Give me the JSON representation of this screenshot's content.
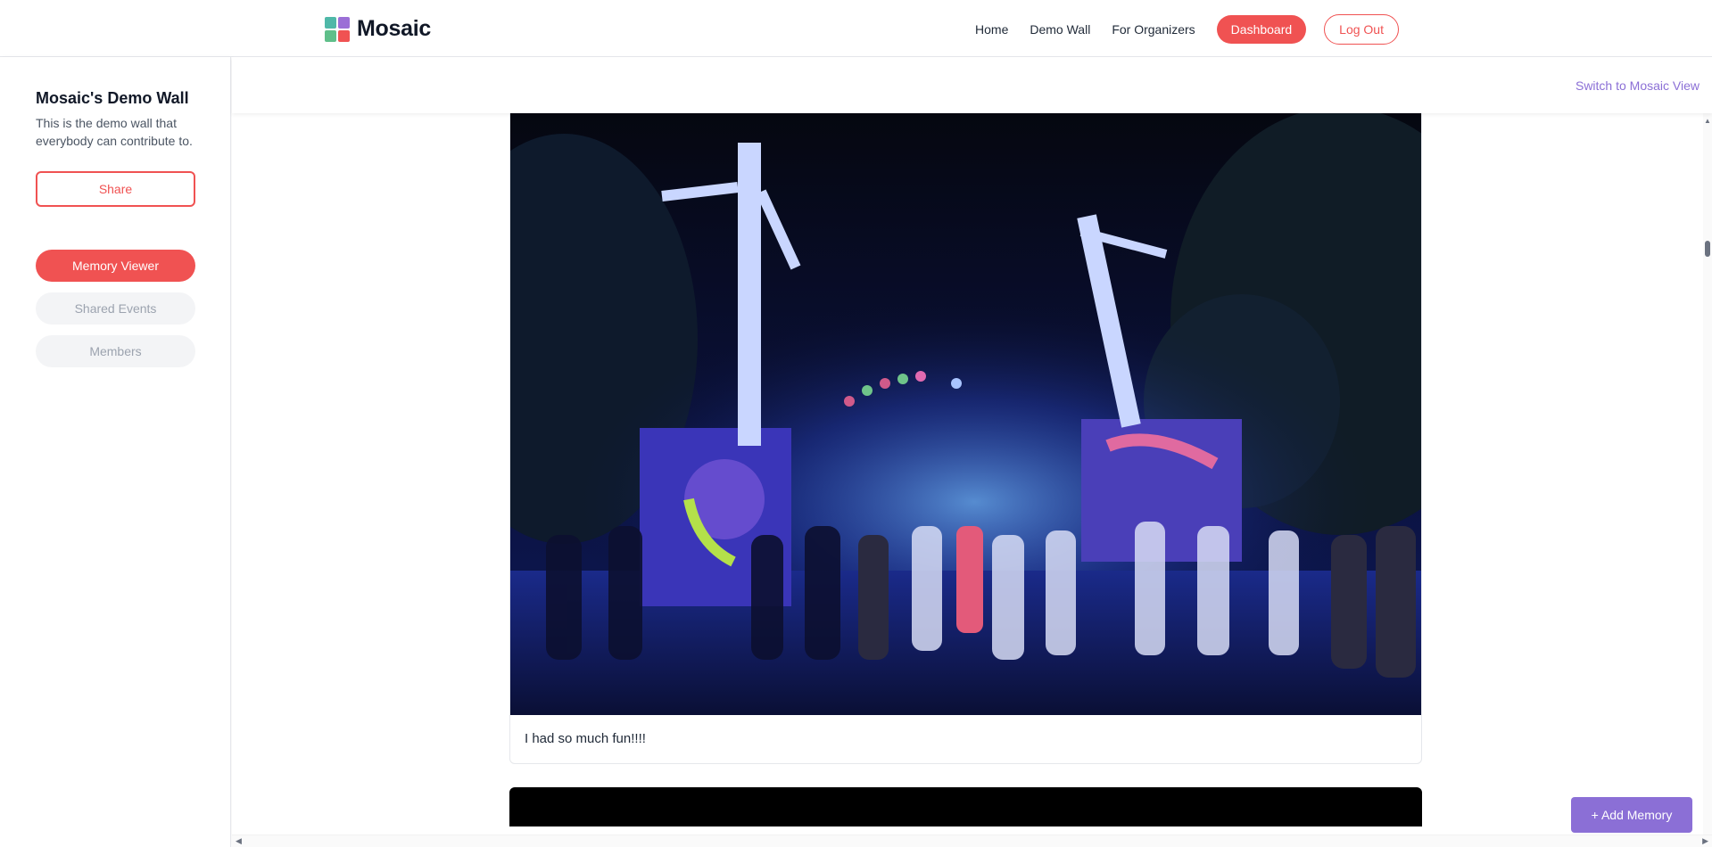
{
  "brand": {
    "name": "Mosaic",
    "logo_colors": [
      "#4fb8a8",
      "#9b6fd6",
      "#5fbf8a",
      "#f05252"
    ]
  },
  "nav": {
    "links": [
      "Home",
      "Demo Wall",
      "For Organizers"
    ],
    "dashboard_label": "Dashboard",
    "logout_label": "Log Out"
  },
  "sidebar": {
    "title": "Mosaic's Demo Wall",
    "description": "This is the demo wall that everybody can contribute to.",
    "share_label": "Share",
    "tabs": [
      {
        "label": "Memory Viewer",
        "active": true
      },
      {
        "label": "Shared Events",
        "active": false
      },
      {
        "label": "Members",
        "active": false
      }
    ]
  },
  "main": {
    "switch_label": "Switch to Mosaic View",
    "memories": [
      {
        "caption": "I had so much fun!!!!"
      }
    ],
    "add_memory_label": "+ Add Memory"
  },
  "colors": {
    "accent": "#f05252",
    "purple": "#8b6fd6"
  }
}
